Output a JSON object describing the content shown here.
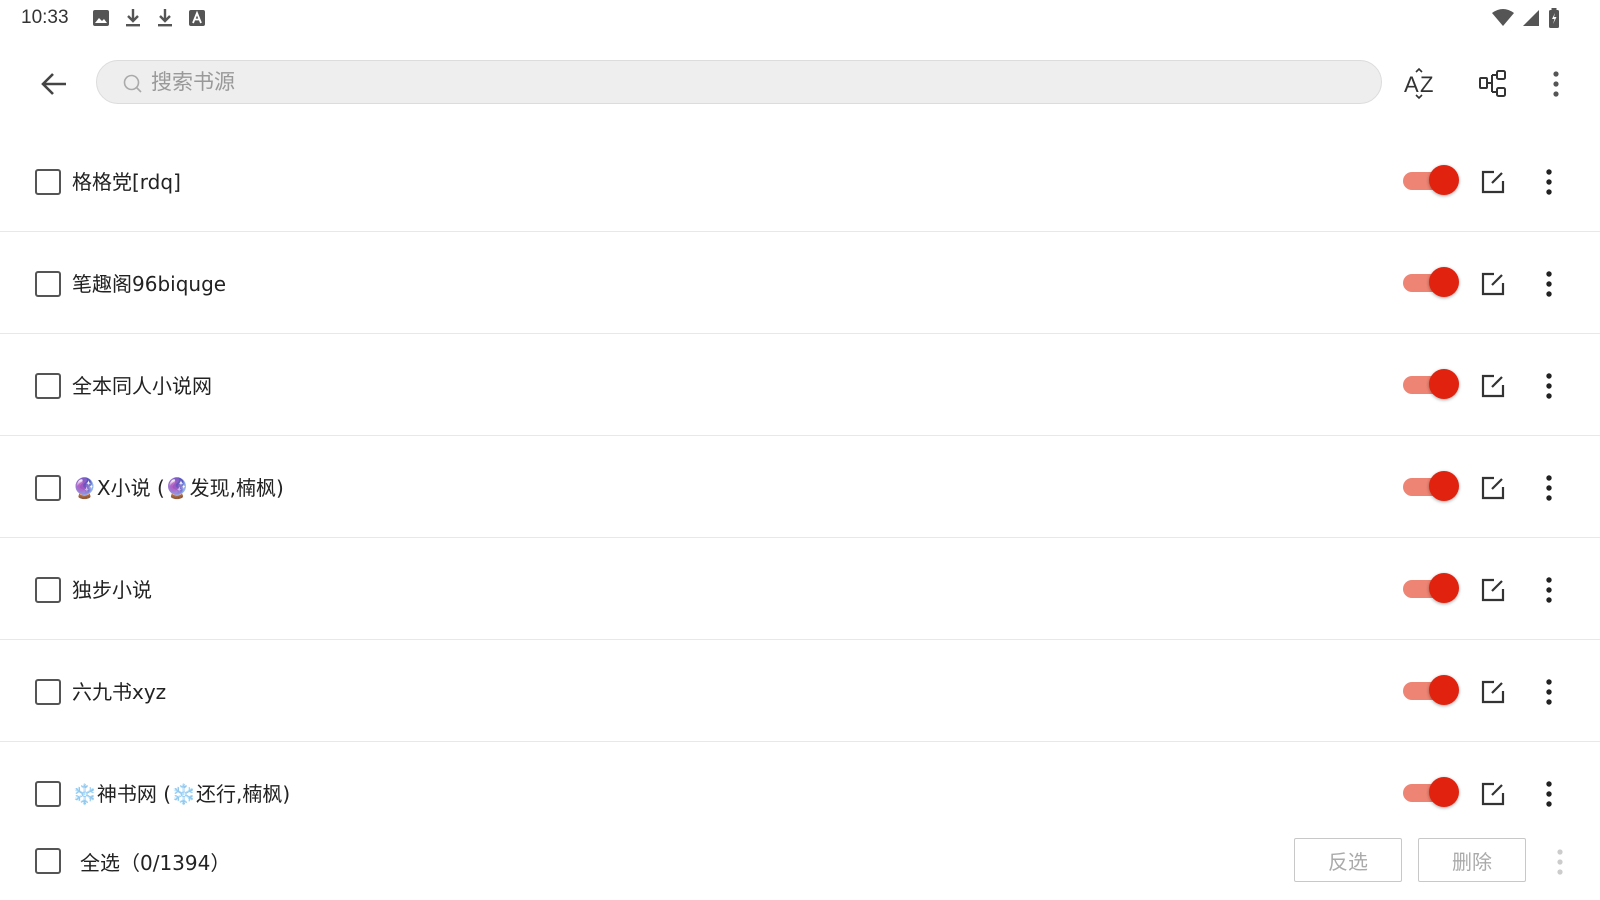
{
  "status_bar": {
    "time": "10:33",
    "left_icons": [
      "image-icon",
      "download-icon",
      "download-icon",
      "font-icon"
    ],
    "right_icons": [
      "wifi-icon",
      "signal-icon",
      "battery-icon"
    ]
  },
  "toolbar": {
    "search_placeholder": "搜索书源",
    "actions": [
      "sort-az-icon",
      "group-icon",
      "more-vert-icon"
    ]
  },
  "sources": [
    {
      "name": "格格党[rdq]",
      "enabled": true
    },
    {
      "name": "笔趣阁96biquge",
      "enabled": true
    },
    {
      "name": "全本同人小说网",
      "enabled": true
    },
    {
      "name": "🔮X小说 (🔮发现,楠枫)",
      "enabled": true
    },
    {
      "name": "独步小说",
      "enabled": true
    },
    {
      "name": "六九书xyz",
      "enabled": true
    },
    {
      "name": "❄️神书网 (❄️还行,楠枫)",
      "enabled": true
    }
  ],
  "bottom_bar": {
    "select_all_label": "全选（0/1394）",
    "invert_label": "反选",
    "delete_label": "删除"
  },
  "colors": {
    "accent": "#e0220f",
    "track": "#ee8473"
  }
}
